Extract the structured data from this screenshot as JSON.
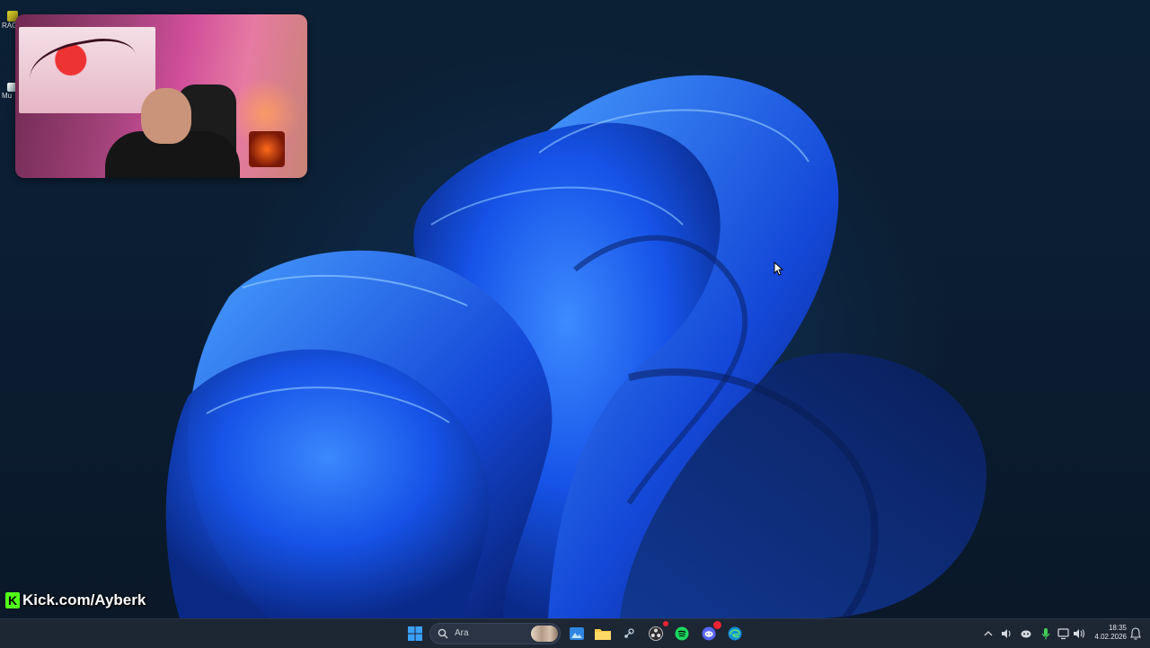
{
  "desktop": {
    "icons": [
      {
        "label": "RAG",
        "icon": "app-shortcut-icon"
      },
      {
        "label": "Mu",
        "icon": "app-shortcut-icon"
      }
    ]
  },
  "overlay": {
    "kick_text": "Kick.com/Ayberk",
    "kick_logo_letter": "K"
  },
  "taskbar": {
    "search_placeholder": "Ara",
    "pinned_apps": [
      "start-icon",
      "search-icon",
      "explorer-icon",
      "photos-icon",
      "folder-icon",
      "steam-icon",
      "obs-icon",
      "spotify-icon",
      "discord-icon",
      "edge-icon"
    ],
    "tray": {
      "clock_time": "18:35",
      "clock_date": "4.02.2026"
    }
  },
  "colors": {
    "taskbar_bg": "#1d2633",
    "kick_green": "#53fc18",
    "spotify_green": "#1ed760",
    "discord_blurple": "#5865f2",
    "wallpaper_blue": "#1a5cff"
  }
}
